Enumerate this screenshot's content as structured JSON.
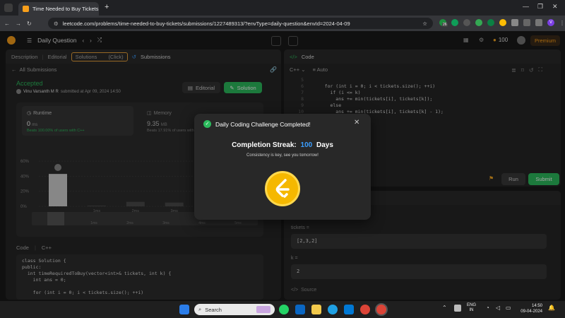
{
  "browser": {
    "tab_title": "Time Needed to Buy Tickets - L",
    "url": "leetcode.com/problems/time-needed-to-buy-tickets/submissions/1227489313/?envType=daily-question&envId=2024-04-09",
    "ext_badge": "26"
  },
  "lc_nav": {
    "title": "Daily Question",
    "coins": "100",
    "premium": "Premium"
  },
  "left_panel": {
    "tabs": {
      "description": "Description",
      "editorial": "Editorial",
      "solutions": "Solutions",
      "click_hint": "(Click)",
      "submissions": "Submissions"
    },
    "back_label": "All Submissions",
    "status": "Accepted",
    "author": "Vinu Varsanth M R",
    "submitted_text": "submitted at Apr 09, 2024 14:50",
    "editorial_btn": "Editorial",
    "solution_btn": "Solution",
    "runtime_label": "Runtime",
    "runtime_value": "0",
    "runtime_unit": "ms",
    "runtime_beats": "Beats 100.00% of users with C++",
    "memory_label": "Memory",
    "memory_value": "9.35",
    "memory_unit": "MB",
    "memory_beats": "Beats 17.91% of users with C++",
    "y_ticks": [
      "60%",
      "40%",
      "20%",
      "0%"
    ],
    "x_ticks": [
      "1ms",
      "2ms",
      "3ms"
    ],
    "mini_ticks": [
      "1ms",
      "2ms",
      "3ms",
      "4ms",
      "5ms"
    ],
    "code_label": "Code",
    "lang": "C++",
    "code_lines": [
      "class Solution {",
      "public:",
      "  int timeRequiredToBuy(vector<int>& tickets, int k) {",
      "    int ans = 0;",
      "",
      "    for (int i = 0; i < tickets.size(); ++i)"
    ]
  },
  "right_panel": {
    "code_title": "Code",
    "lang": "C++",
    "auto_label": "Auto",
    "line_numbers": [
      "5",
      "6",
      "7",
      "8",
      "9",
      "10",
      "11"
    ],
    "code_lines": [
      "",
      "    for (int i = 0; i < tickets.size(); ++i)",
      "      if (i <= k)",
      "        ans += min(tickets[i], tickets[k]);",
      "      else",
      "        ans += min(tickets[i], tickets[k] - 1);",
      ""
    ],
    "run_btn": "Run",
    "submit_btn": "Submit",
    "tickets_label": "tickets =",
    "tickets_value": "[2,3,2]",
    "k_label": "k =",
    "k_value": "2",
    "source_label": "Source"
  },
  "modal": {
    "title": "Daily Coding Challenge Completed!",
    "streak_label": "Completion Streak:",
    "streak_value": "100",
    "streak_unit": "Days",
    "subtitle": "Consistency is key, see you tomorrow!"
  },
  "taskbar": {
    "search_placeholder": "Search",
    "lang_top": "ENG",
    "lang_bottom": "IN",
    "time": "14:50",
    "date": "09-04-2024"
  },
  "colors": {
    "accent_green": "#2cbb5d",
    "streak_blue": "#3b9eff",
    "coin_gold": "#f5b800",
    "solutions_highlight": "#e8a23a"
  },
  "chart_data": {
    "type": "bar",
    "categories": [
      "0ms",
      "1ms",
      "2ms",
      "3ms",
      "4ms"
    ],
    "values": [
      43,
      1,
      6,
      5,
      14
    ],
    "ylim": [
      0,
      60
    ],
    "xlabel": "",
    "ylabel": ""
  }
}
